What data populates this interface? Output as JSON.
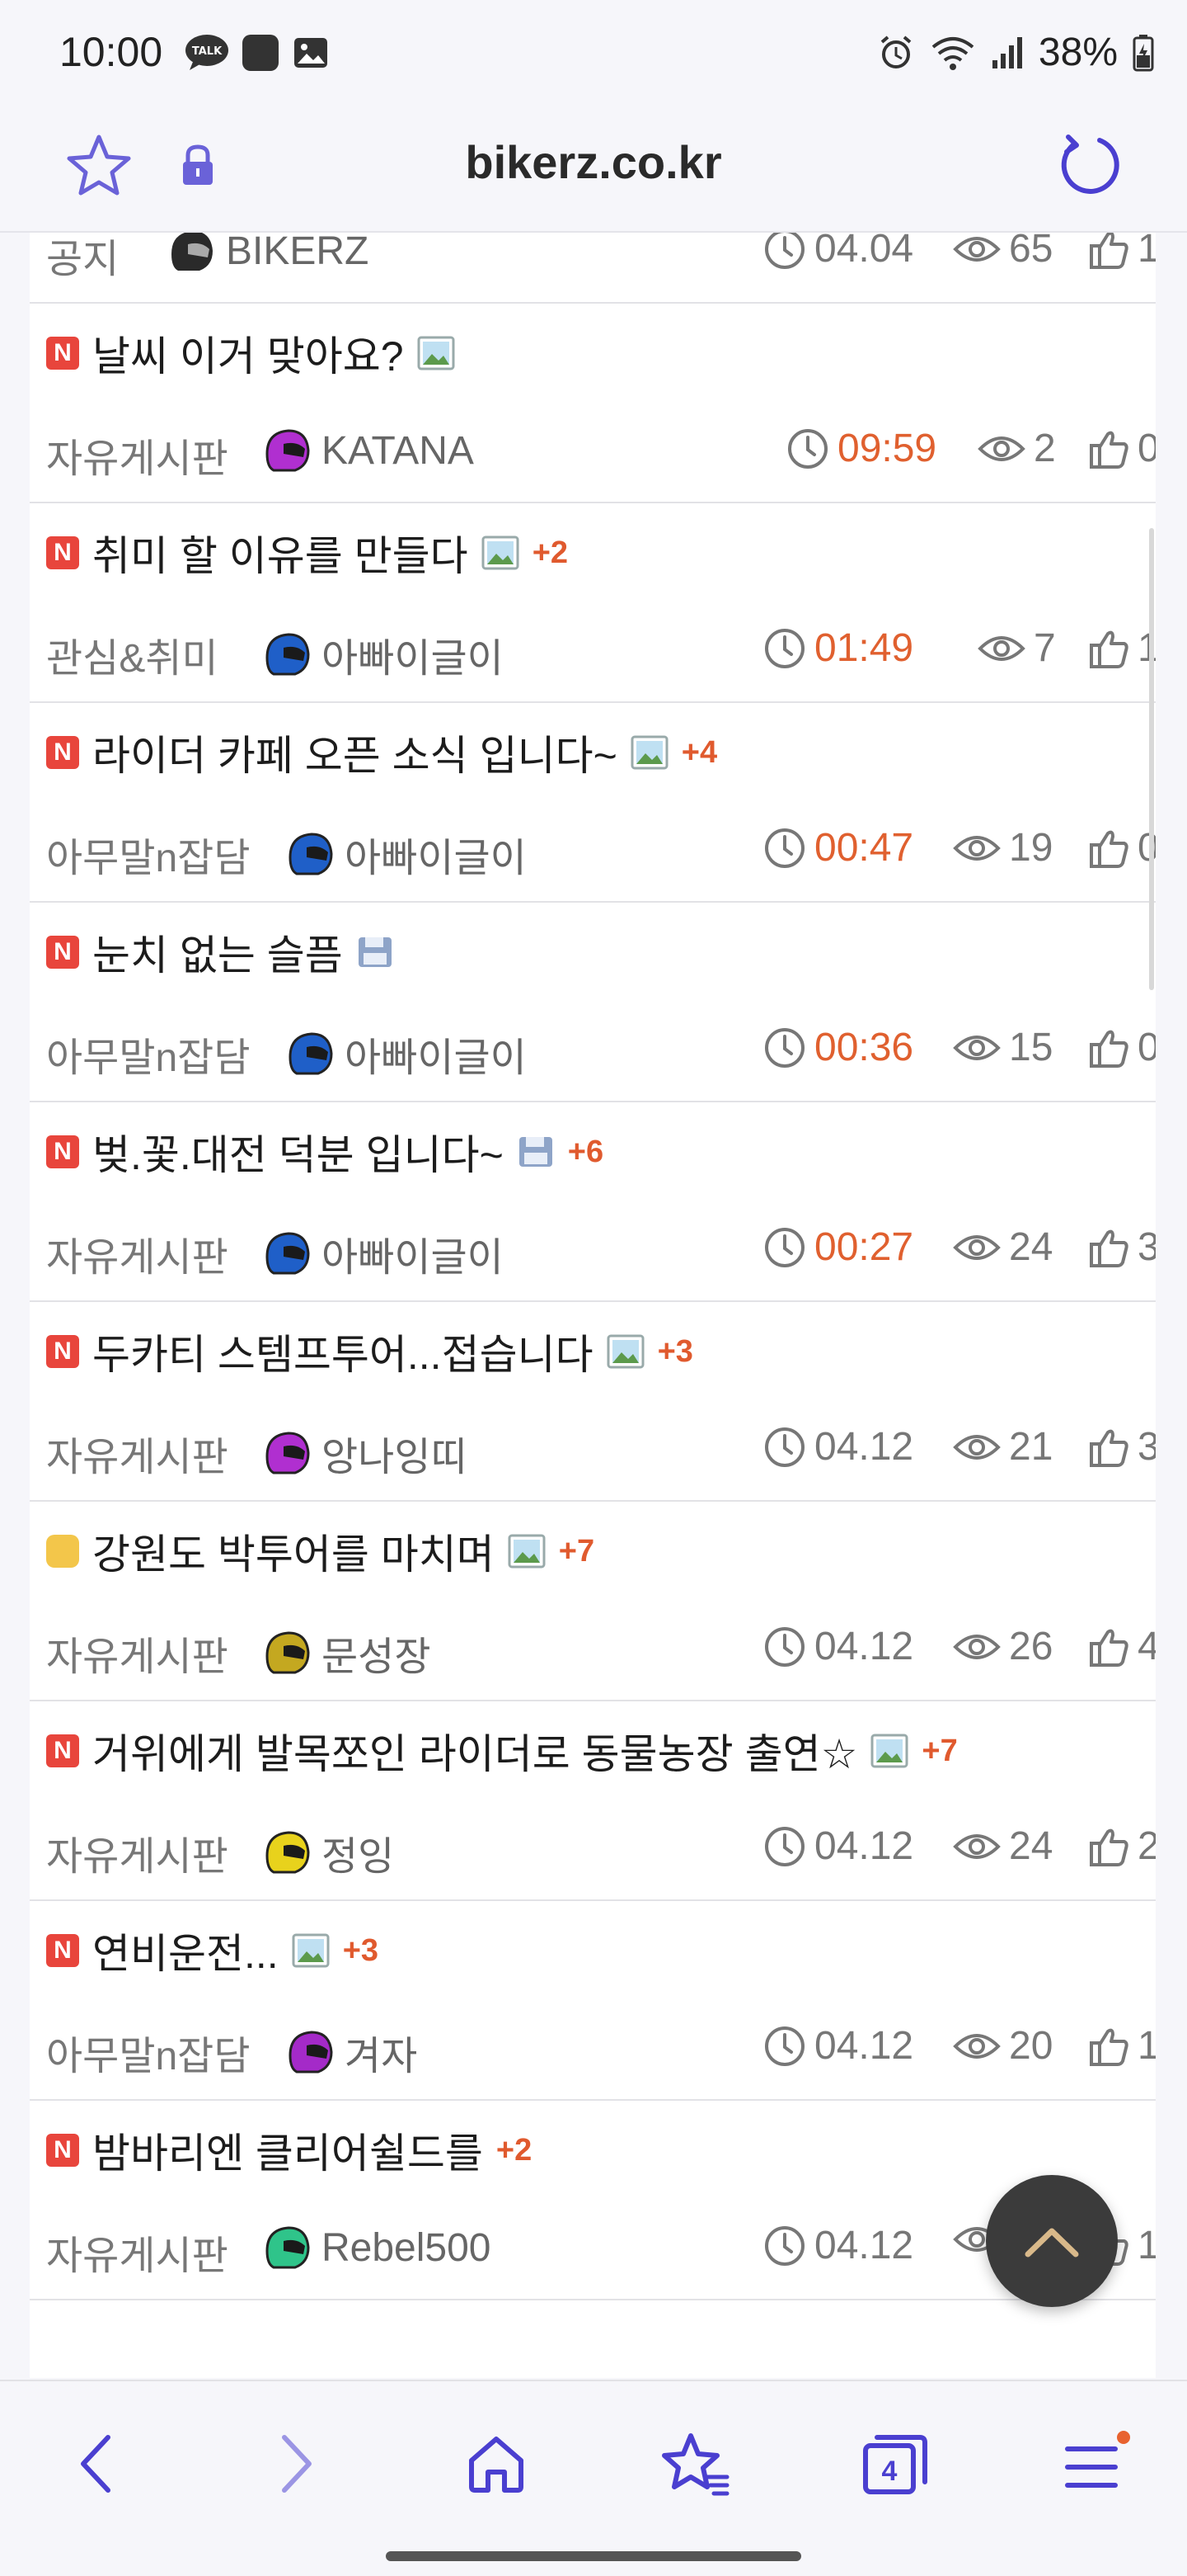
{
  "status_bar": {
    "time": "10:00",
    "battery": "38%"
  },
  "browser": {
    "url": "bikerz.co.kr"
  },
  "partial_row": {
    "board": "공지",
    "author": "BIKERZ",
    "time": "04.04",
    "views": "65",
    "likes": "1"
  },
  "posts": [
    {
      "title": "날씨 이거 맞아요?",
      "badge": "new",
      "attachment": "image",
      "replies": "",
      "board": "자유게시판",
      "author": "KATANA",
      "helmet": "#b02fd0",
      "time": "09:59",
      "recent": true,
      "views": "2",
      "likes": "0"
    },
    {
      "title": "취미 할 이유를 만들다",
      "badge": "new",
      "attachment": "image",
      "replies": "+2",
      "board": "관심&취미",
      "author": "아빠이글이",
      "helmet": "#1f5fc8",
      "time": "01:49",
      "recent": true,
      "views": "7",
      "likes": "1"
    },
    {
      "title": "라이더 카페 오픈 소식 입니다~",
      "badge": "new",
      "attachment": "image",
      "replies": "+4",
      "board": "아무말n잡담",
      "author": "아빠이글이",
      "helmet": "#1f5fc8",
      "time": "00:47",
      "recent": true,
      "views": "19",
      "likes": "0"
    },
    {
      "title": "눈치 없는 슬픔",
      "badge": "new",
      "attachment": "file",
      "replies": "",
      "board": "아무말n잡담",
      "author": "아빠이글이",
      "helmet": "#1f5fc8",
      "time": "00:36",
      "recent": true,
      "views": "15",
      "likes": "0"
    },
    {
      "title": "벚.꽃.대전 덕분 입니다~",
      "badge": "new",
      "attachment": "file",
      "replies": "+6",
      "board": "자유게시판",
      "author": "아빠이글이",
      "helmet": "#1f5fc8",
      "time": "00:27",
      "recent": true,
      "views": "24",
      "likes": "3"
    },
    {
      "title": "두카티 스템프투어...접습니다",
      "badge": "new",
      "attachment": "image",
      "replies": "+3",
      "board": "자유게시판",
      "author": "앙나잉띠",
      "helmet": "#b02fd0",
      "time": "04.12",
      "recent": false,
      "views": "21",
      "likes": "3"
    },
    {
      "title": "강원도 박투어를 마치며",
      "badge": "hot",
      "attachment": "image",
      "replies": "+7",
      "board": "자유게시판",
      "author": "문성장",
      "helmet": "#c4a820",
      "time": "04.12",
      "recent": false,
      "views": "26",
      "likes": "4"
    },
    {
      "title": "거위에게 발목쪼인 라이더로 동물농장 출연☆",
      "badge": "new",
      "attachment": "image",
      "replies": "+7",
      "board": "자유게시판",
      "author": "정잉",
      "helmet": "#e8d21c",
      "time": "04.12",
      "recent": false,
      "views": "24",
      "likes": "2"
    },
    {
      "title": "연비운전...",
      "badge": "new",
      "attachment": "image",
      "replies": "+3",
      "board": "아무말n잡담",
      "author": "겨자",
      "helmet": "#a42ac8",
      "time": "04.12",
      "recent": false,
      "views": "20",
      "likes": "1"
    },
    {
      "title": "밤바리엔 클리어쉴드를",
      "badge": "new",
      "attachment": "",
      "replies": "+2",
      "board": "자유게시판",
      "author": "Rebel500",
      "helmet": "#2fc48a",
      "time": "04.12",
      "recent": false,
      "views": "",
      "likes": "1"
    }
  ],
  "nav": {
    "tabs_count": "4"
  },
  "colors": {
    "accent": "#4a3fd0",
    "recent_time": "#e0602f",
    "new_badge": "#e8453c"
  }
}
